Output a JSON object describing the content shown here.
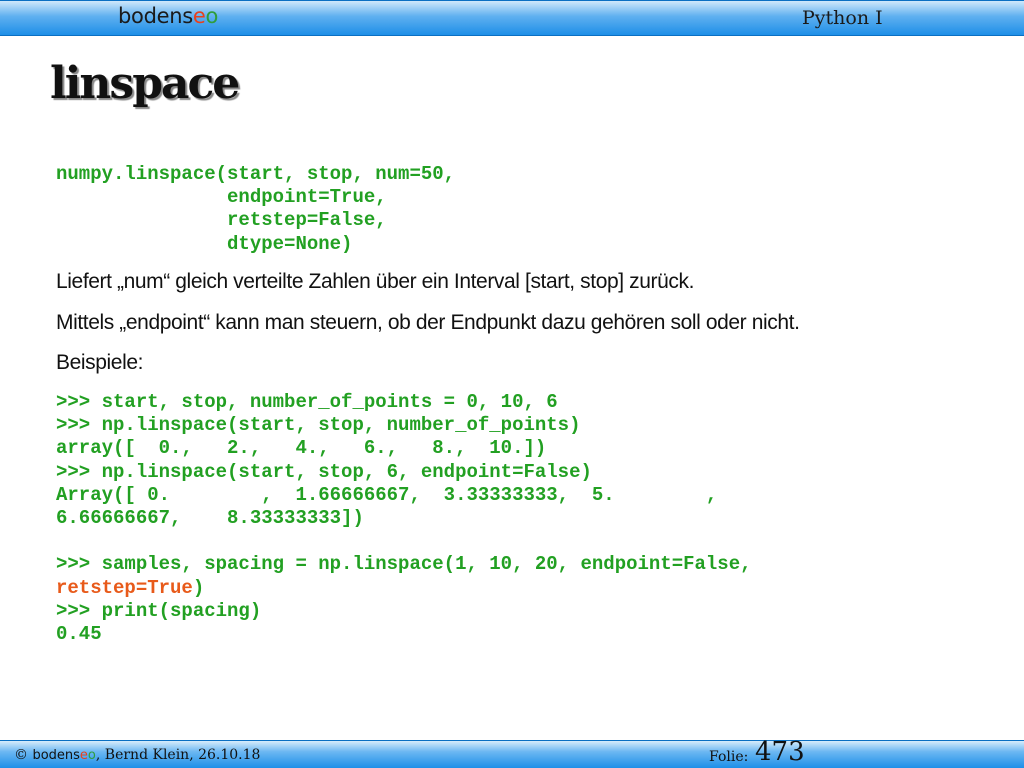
{
  "header": {
    "logo": {
      "part1": "bodens",
      "part2": "e",
      "part3": "o"
    },
    "course": "Python I"
  },
  "slide": {
    "title": "linspace",
    "signature": "numpy.linspace(start, stop, num=50,\n               endpoint=True,\n               retstep=False,\n               dtype=None)",
    "paragraphs": [
      "Liefert „num“ gleich verteilte Zahlen über ein Interval [start, stop]  zurück.",
      "Mittels „endpoint“ kann man steuern, ob der Endpunkt dazu gehören soll oder nicht.",
      "Beispiele:"
    ],
    "example_lines": [
      ">>> start, stop, number_of_points = 0, 10, 6",
      ">>> np.linspace(start, stop, number_of_points)",
      "array([  0.,   2.,   4.,   6.,   8.,  10.])",
      ">>> np.linspace(start, stop, 6, endpoint=False)",
      "Array([ 0.        ,  1.66666667,  3.33333333,  5.        ,",
      "6.66666667,    8.33333333])",
      "",
      ">>> samples, spacing = np.linspace(1, 10, 20, endpoint=False,"
    ],
    "example_highlight": "retstep=True",
    "example_highlight_tail": ")",
    "example_tail_lines": [
      ">>> print(spacing)",
      "0.45"
    ]
  },
  "footer": {
    "copyright": "©",
    "brand": {
      "part1": "bodens",
      "part2": "e",
      "part3": "o"
    },
    "author_date": ", Bernd Klein, 26.10.18",
    "folie_label": "Folie:",
    "folie_number": "473"
  },
  "colors": {
    "code_green": "#22a022",
    "highlight_red": "#e85a1a",
    "bar_blue": "#1e8fe8"
  }
}
